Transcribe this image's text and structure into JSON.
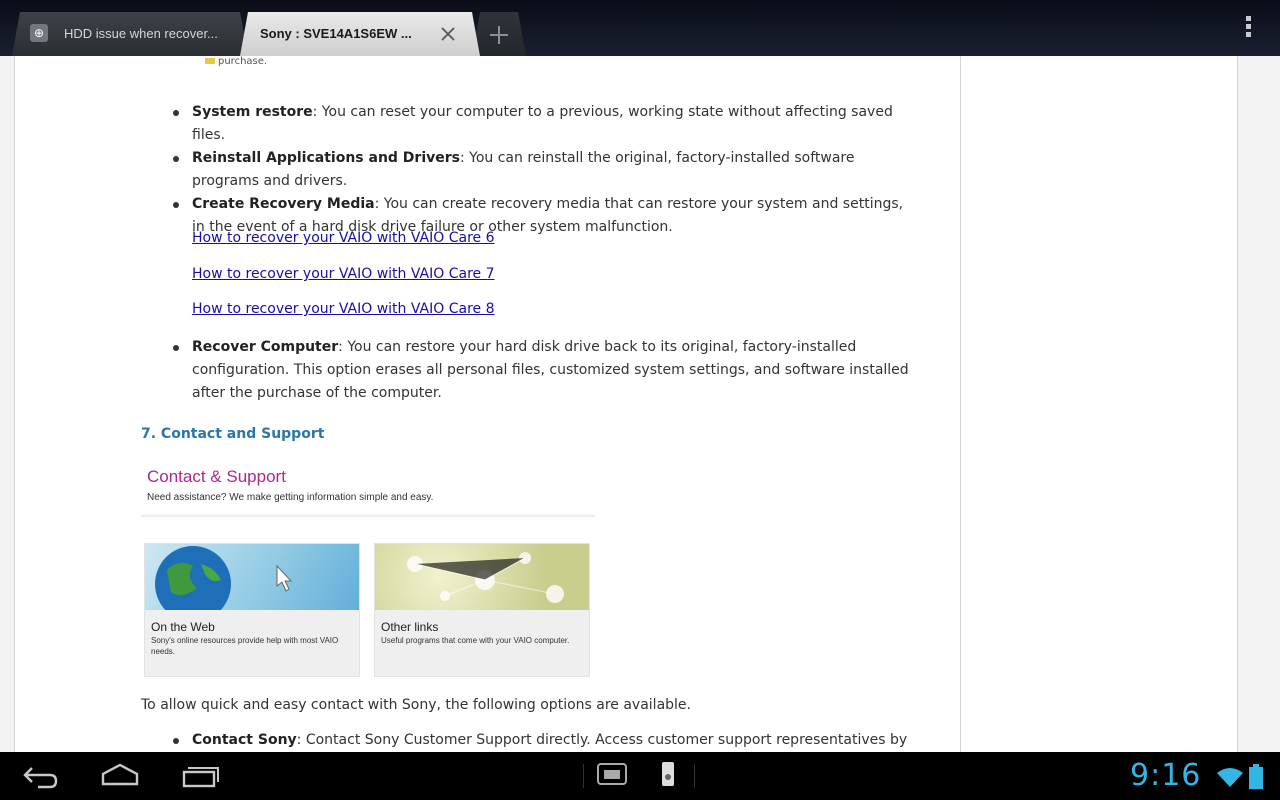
{
  "tabs": [
    {
      "title": "HDD issue when recover...",
      "active": false,
      "favicon": "globe-icon"
    },
    {
      "title": "Sony : SVE14A1S6EW ...",
      "active": true
    }
  ],
  "top_fragment": "purchase.",
  "list_a": [
    {
      "label": "System restore",
      "text": ": You can reset your computer to a previous, working state without affecting saved files."
    },
    {
      "label": "Reinstall Applications and Drivers",
      "text": ": You can reinstall the original, factory-installed software programs and drivers."
    },
    {
      "label": "Create Recovery Media",
      "text": ": You can create recovery media that can restore your system and settings, in the event of a hard disk drive failure or other system malfunction."
    }
  ],
  "links": [
    "How to recover your VAIO with VAIO Care 6",
    "How to recover your VAIO with VAIO Care 7",
    "How to recover your VAIO with VAIO Care 8"
  ],
  "list_b": [
    {
      "label": "Recover Computer",
      "text": ": You can restore your hard disk drive back to its original, factory-installed configuration. This option erases all personal files, customized system settings, and software installed after the purchase of the computer."
    }
  ],
  "section_heading": "7. Contact and Support",
  "contact_image": {
    "title": "Contact & Support",
    "subtitle": "Need assistance? We make getting information simple and easy.",
    "cards": [
      {
        "title": "On the Web",
        "desc": "Sony's online resources provide help with most VAIO needs."
      },
      {
        "title": "Other links",
        "desc": "Useful programs that come with your VAIO computer."
      }
    ]
  },
  "options_intro": "To allow quick and easy contact with Sony, the following options are available.",
  "list_c": [
    {
      "label": "Contact Sony",
      "text": ": Contact Sony Customer Support directly. Access customer support representatives by"
    }
  ],
  "status": {
    "clock": "9:16"
  },
  "colors": {
    "heading": "#2a77a6",
    "link": "#1a0dab",
    "clock": "#33b5e5",
    "contact_title": "#b0268c"
  }
}
